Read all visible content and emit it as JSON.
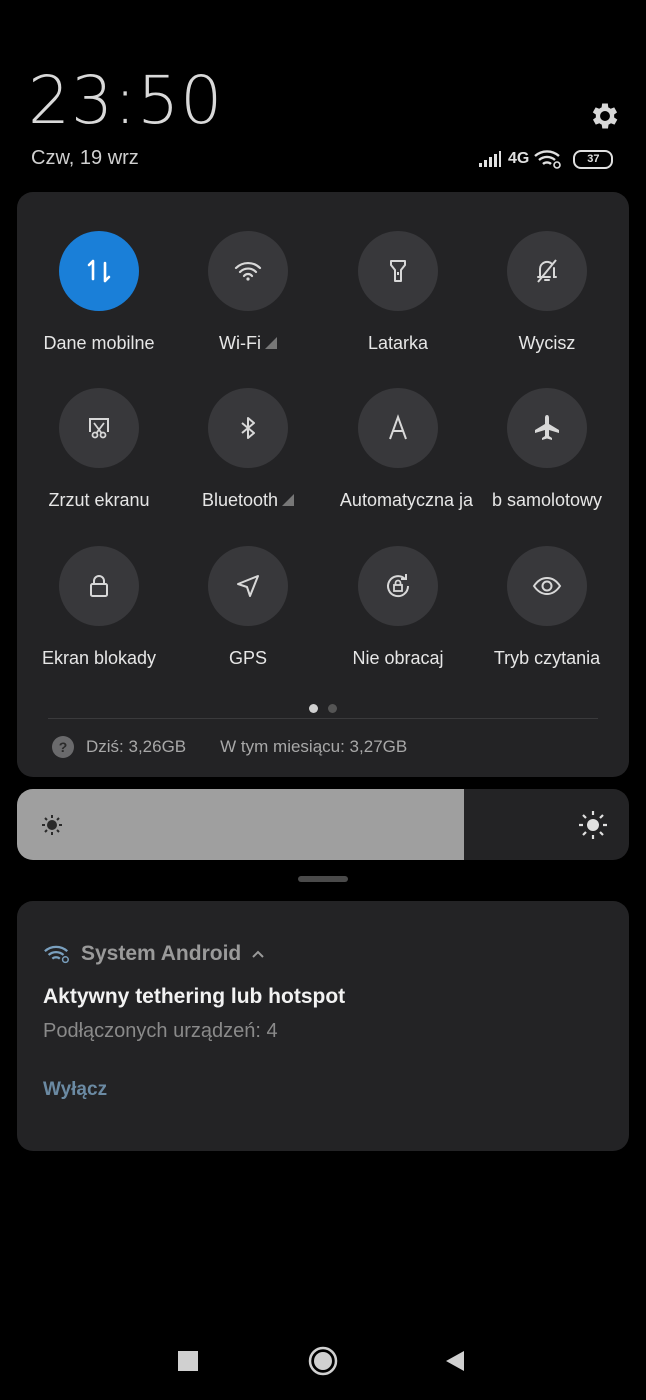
{
  "status": {
    "time": "23:50",
    "date": "Czw, 19 wrz",
    "network": "4G",
    "battery": "37"
  },
  "tiles": [
    {
      "label": "Dane mobilne",
      "icon": "mobile-data-icon",
      "active": true
    },
    {
      "label": "Wi-Fi",
      "icon": "wifi-icon",
      "active": false
    },
    {
      "label": "Latarka",
      "icon": "flashlight-icon",
      "active": false
    },
    {
      "label": "Wycisz",
      "icon": "bell-off-icon",
      "active": false
    },
    {
      "label": "Zrzut ekranu",
      "icon": "screenshot-scissors-icon",
      "active": false
    },
    {
      "label": "Bluetooth",
      "icon": "bluetooth-icon",
      "active": false
    },
    {
      "label": "Automatyczna ja",
      "icon": "auto-brightness-icon",
      "active": false
    },
    {
      "label": "b samolotowy",
      "icon": "airplane-icon",
      "active": false
    },
    {
      "label": "Ekran blokady",
      "icon": "lock-icon",
      "active": false
    },
    {
      "label": "GPS",
      "icon": "location-arrow-icon",
      "active": false
    },
    {
      "label": "Nie obracaj",
      "icon": "rotation-lock-icon",
      "active": false
    },
    {
      "label": "Tryb czytania",
      "icon": "eye-icon",
      "active": false
    }
  ],
  "pager": {
    "pages": 2,
    "current": 1
  },
  "usage": {
    "today": "Dziś: 3,26GB",
    "month": "W tym miesiącu: 3,27GB"
  },
  "brightness": {
    "level": 0.73
  },
  "notification": {
    "app": "System Android",
    "title": "Aktywny tethering lub hotspot",
    "text": "Podłączonych urządzeń: 4",
    "action": "Wyłącz"
  },
  "colors": {
    "accent": "#1a7fd8",
    "panel": "#232325",
    "action": "#6b8aa3"
  }
}
